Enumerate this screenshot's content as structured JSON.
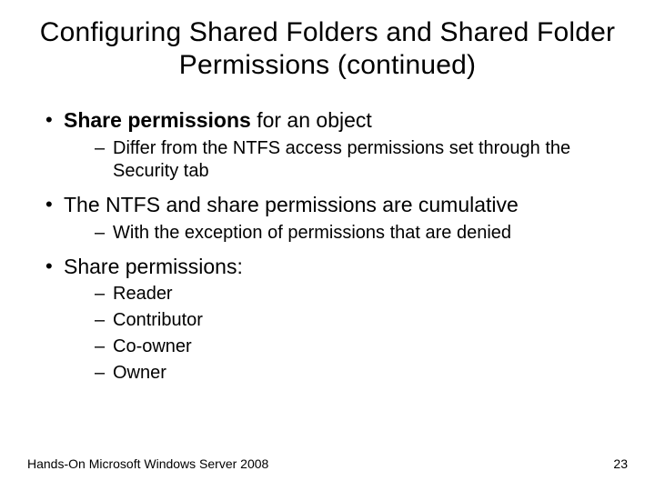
{
  "title": "Configuring Shared Folders and Shared Folder Permissions (continued)",
  "bullets": {
    "b1_bold": "Share permissions",
    "b1_rest": " for an object",
    "b1_sub1": "Differ from the NTFS access permissions set through the Security tab",
    "b2": "The NTFS and share permissions are cumulative",
    "b2_sub1": "With the exception of permissions that are denied",
    "b3": "Share permissions:",
    "b3_sub1": "Reader",
    "b3_sub2": "Contributor",
    "b3_sub3": "Co-owner",
    "b3_sub4": "Owner"
  },
  "footer": {
    "left": "Hands-On Microsoft Windows Server 2008",
    "right": "23"
  }
}
